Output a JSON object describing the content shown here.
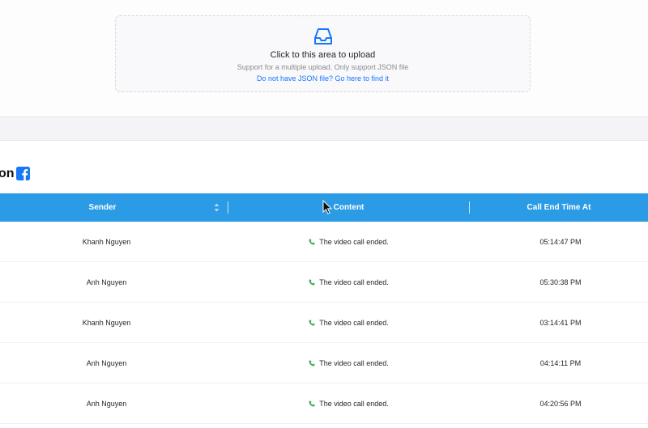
{
  "upload": {
    "title": "Click to this area to upload",
    "hint": "Support for a multiple upload. Only support JSON file",
    "link": "Do not have JSON file? Go here to find it",
    "icon": "inbox-icon",
    "accent": "#1677ff"
  },
  "section": {
    "title": "on",
    "icon": "facebook-icon",
    "icon_color": "#1877f2"
  },
  "table": {
    "header_color": "#2b9be6",
    "columns": {
      "sender": "Sender",
      "content": "Content",
      "end_time": "Call End Time At"
    },
    "rows": [
      {
        "sender": "Khanh Nguyen",
        "content": "The video call ended.",
        "end_time": "05:14:47 PM"
      },
      {
        "sender": "Anh Nguyen",
        "content": "The video call ended.",
        "end_time": "05:30:38 PM"
      },
      {
        "sender": "Khanh Nguyen",
        "content": "The video call ended.",
        "end_time": "03:14:41 PM"
      },
      {
        "sender": "Anh Nguyen",
        "content": "The video call ended.",
        "end_time": "04:14:11 PM"
      },
      {
        "sender": "Anh Nguyen",
        "content": "The video call ended.",
        "end_time": "04:20:56 PM"
      }
    ]
  }
}
